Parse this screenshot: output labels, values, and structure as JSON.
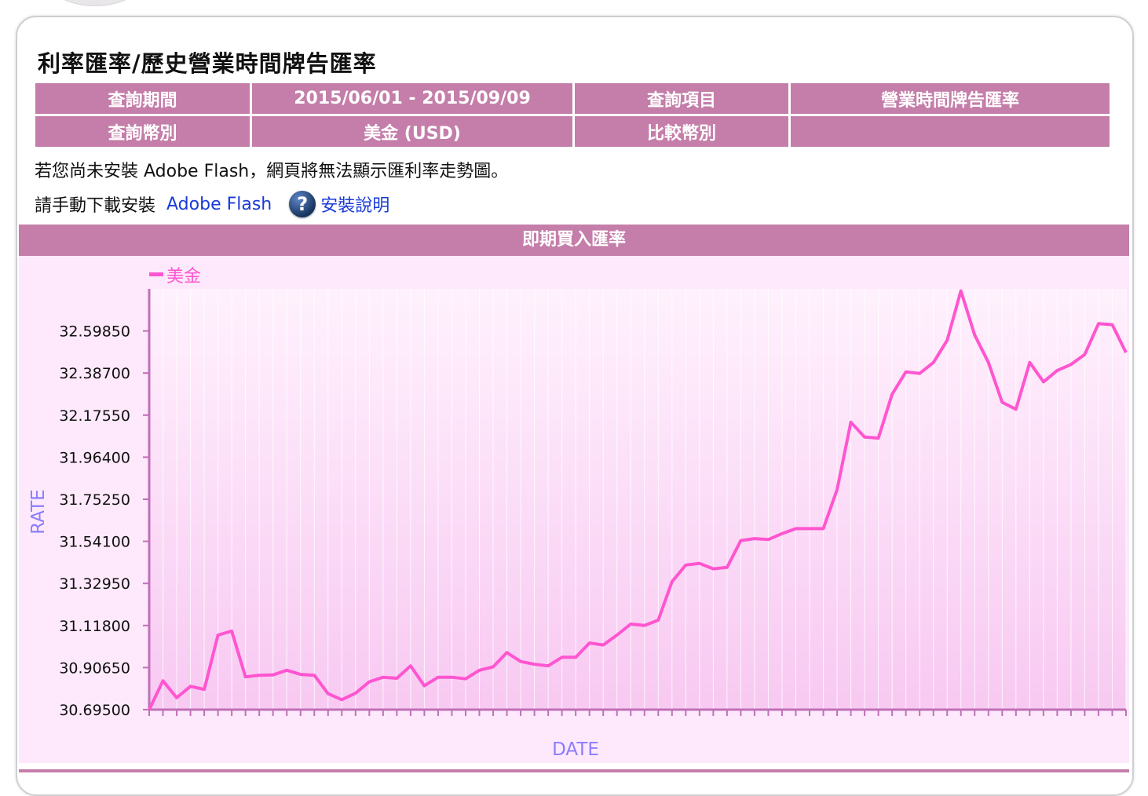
{
  "page": {
    "title": "利率匯率/歷史營業時間牌告匯率"
  },
  "info_table": {
    "period_label": "查詢期間",
    "period_value": "2015/06/01 - 2015/09/09",
    "item_label": "查詢項目",
    "item_value": "營業時間牌告匯率",
    "currency_label": "查詢幣別",
    "currency_value": "美金 (USD)",
    "compare_label": "比較幣別",
    "compare_value": ""
  },
  "notice": {
    "flash_warning": "若您尚未安裝 Adobe Flash，網頁將無法顯示匯利率走勢圖。",
    "download_prefix": "請手動下載安裝",
    "adobe_link": "Adobe Flash",
    "help_icon": "question-circle-icon",
    "install_help": "安裝說明"
  },
  "chart_header": "即期買入匯率",
  "colors": {
    "header_bg": "#c47ea9",
    "chart_bg": "#fde9fb",
    "series_line": "#ff55d0",
    "axis_label": "#8b7cff",
    "link": "#1a3ad8"
  },
  "chart_data": {
    "type": "line",
    "title": "",
    "xlabel": "DATE",
    "ylabel": "RATE",
    "ylim": [
      30.695,
      32.81
    ],
    "yticks": [
      30.695,
      30.9065,
      31.118,
      31.3295,
      31.541,
      31.7525,
      31.964,
      32.1755,
      32.387,
      32.5985
    ],
    "ytick_labels": [
      "30.69500",
      "30.90650",
      "31.11800",
      "31.32950",
      "31.54100",
      "31.75250",
      "31.96400",
      "32.17550",
      "32.38700",
      "32.59850"
    ],
    "legend": "top-left",
    "grid": true,
    "series": [
      {
        "name": "美金",
        "values": [
          30.695,
          30.84,
          30.755,
          30.812,
          30.797,
          31.07,
          31.09,
          30.86,
          30.868,
          30.87,
          30.893,
          30.872,
          30.868,
          30.775,
          30.745,
          30.778,
          30.835,
          30.858,
          30.853,
          30.915,
          30.815,
          30.858,
          30.858,
          30.85,
          30.893,
          30.91,
          30.982,
          30.937,
          30.923,
          30.915,
          30.958,
          30.958,
          31.03,
          31.02,
          31.07,
          31.125,
          31.118,
          31.145,
          31.338,
          31.422,
          31.43,
          31.403,
          31.41,
          31.545,
          31.555,
          31.55,
          31.58,
          31.605,
          31.605,
          31.605,
          31.802,
          32.14,
          32.065,
          32.06,
          32.28,
          32.393,
          32.385,
          32.44,
          32.551,
          32.8,
          32.578,
          32.44,
          32.24,
          32.205,
          32.44,
          32.343,
          32.4,
          32.43,
          32.48,
          32.635,
          32.63,
          32.49
        ]
      }
    ]
  }
}
